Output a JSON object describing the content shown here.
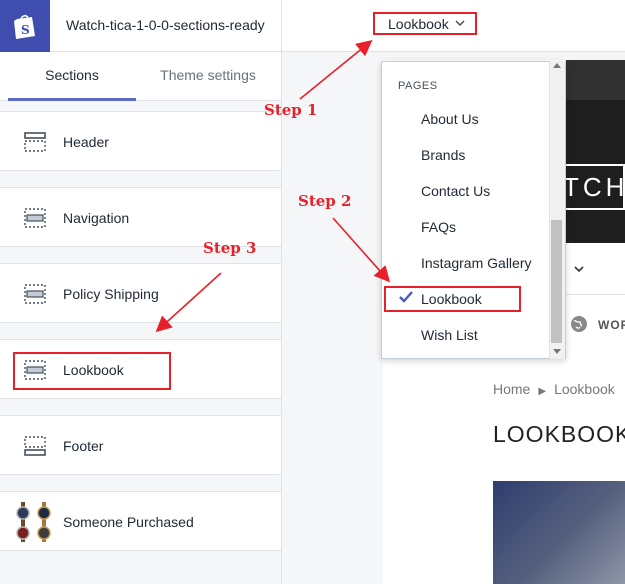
{
  "editor": {
    "theme_name": "Watch-tica-1-0-0-sections-ready",
    "tabs": [
      {
        "label": "Sections",
        "active": true
      },
      {
        "label": "Theme settings",
        "active": false
      }
    ],
    "sections": [
      {
        "label": "Header",
        "icon": "header-section-icon"
      },
      {
        "label": "Navigation",
        "icon": "navigation-section-icon"
      },
      {
        "label": "Policy Shipping",
        "icon": "section-icon"
      },
      {
        "label": "Lookbook",
        "icon": "section-icon"
      },
      {
        "label": "Footer",
        "icon": "footer-section-icon"
      },
      {
        "label": "Someone Purchased",
        "icon": "watches-thumbnail"
      }
    ]
  },
  "page_selector": {
    "value": "Lookbook"
  },
  "dropdown": {
    "heading": "PAGES",
    "items": [
      "About Us",
      "Brands",
      "Contact Us",
      "FAQs",
      "Instagram Gallery",
      "Lookbook",
      "Wish List"
    ],
    "selected": "Lookbook"
  },
  "preview": {
    "logo_text": "WATCH",
    "nav_text": "WOR",
    "breadcrumb": {
      "home": "Home",
      "current": "Lookbook"
    },
    "heading": "LOOKBOOK"
  },
  "annotations": {
    "step1": "Step 1",
    "step2": "Step 2",
    "step3": "Step 3"
  },
  "colors": {
    "accent": "#5c6ac4",
    "shopify": "#3f4eae",
    "annotation": "#e8202a",
    "check": "#4959bd"
  }
}
